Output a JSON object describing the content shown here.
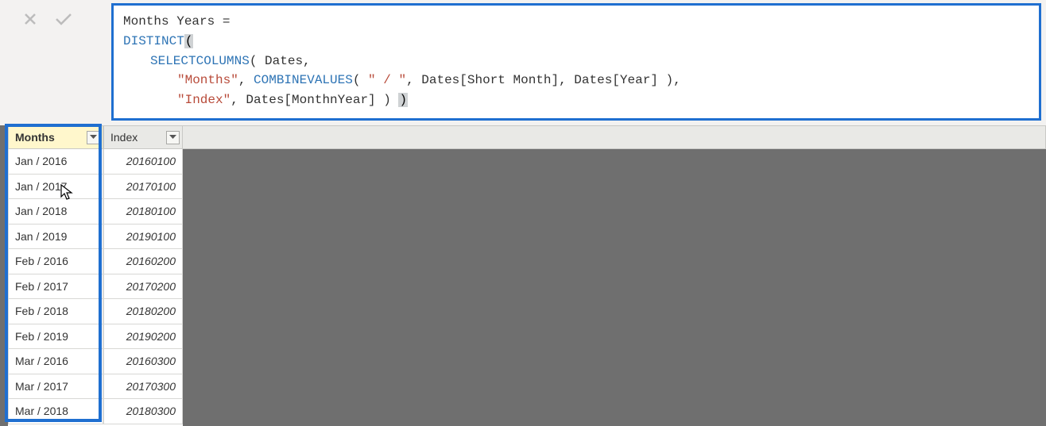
{
  "formula": {
    "measure_name": "Months Years",
    "fn_distinct": "DISTINCT",
    "fn_selectcolumns": "SELECTCOLUMNS",
    "fn_combinevalues": "COMBINEVALUES",
    "tbl": "Dates",
    "str_months": "\"Months\"",
    "str_sep": "\" / \"",
    "str_index": "\"Index\"",
    "col_shortmonth": "Dates[Short Month]",
    "col_year": "Dates[Year]",
    "col_monthnyear": "Dates[MonthnYear]"
  },
  "columns": {
    "months": {
      "header": "Months"
    },
    "index": {
      "header": "Index"
    }
  },
  "rows": [
    {
      "months": "Jan / 2016",
      "index": "20160100"
    },
    {
      "months": "Jan / 2017",
      "index": "20170100"
    },
    {
      "months": "Jan / 2018",
      "index": "20180100"
    },
    {
      "months": "Jan / 2019",
      "index": "20190100"
    },
    {
      "months": "Feb / 2016",
      "index": "20160200"
    },
    {
      "months": "Feb / 2017",
      "index": "20170200"
    },
    {
      "months": "Feb / 2018",
      "index": "20180200"
    },
    {
      "months": "Feb / 2019",
      "index": "20190200"
    },
    {
      "months": "Mar / 2016",
      "index": "20160300"
    },
    {
      "months": "Mar / 2017",
      "index": "20170300"
    },
    {
      "months": "Mar / 2018",
      "index": "20180300"
    }
  ]
}
